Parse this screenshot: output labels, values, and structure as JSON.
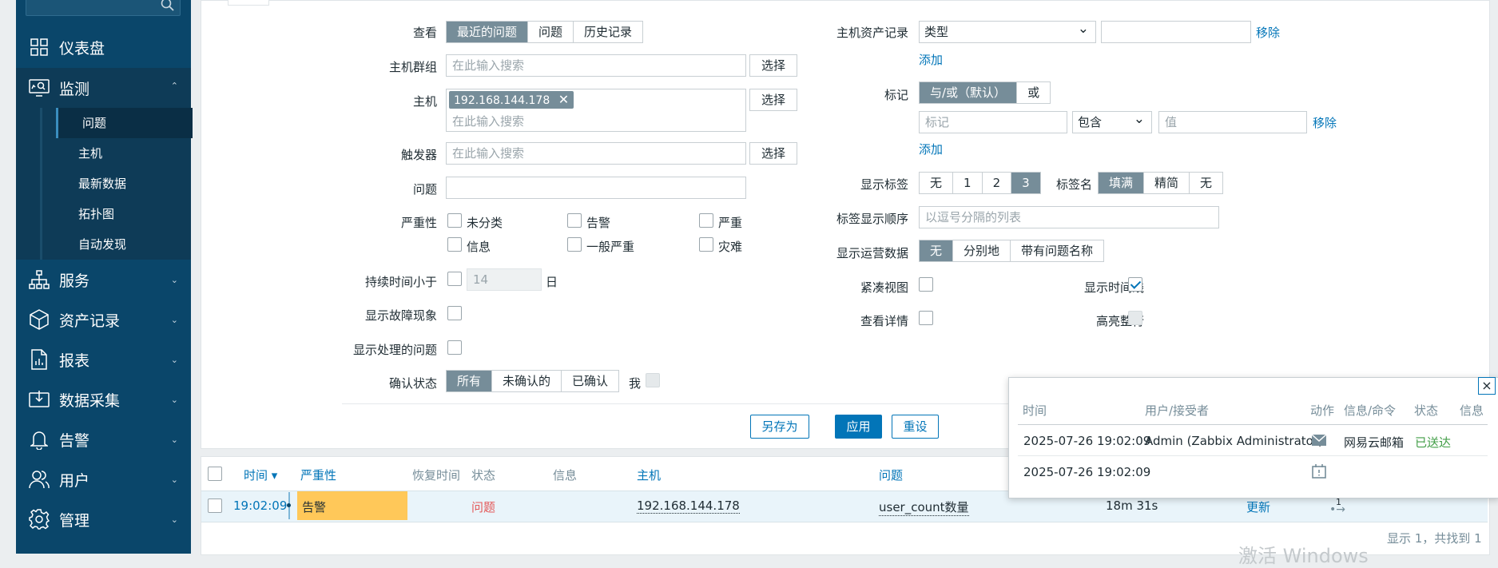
{
  "sidebar": {
    "items": [
      {
        "label": "仪表盘",
        "icon": "dashboard-icon"
      },
      {
        "label": "监测",
        "icon": "monitoring-icon"
      },
      {
        "label": "服务",
        "icon": "services-icon"
      },
      {
        "label": "资产记录",
        "icon": "inventory-icon"
      },
      {
        "label": "报表",
        "icon": "reports-icon"
      },
      {
        "label": "数据采集",
        "icon": "data-collection-icon"
      },
      {
        "label": "告警",
        "icon": "alerts-icon"
      },
      {
        "label": "用户",
        "icon": "users-icon"
      },
      {
        "label": "管理",
        "icon": "administration-icon"
      }
    ],
    "submenu": [
      "问题",
      "主机",
      "最新数据",
      "拓扑图",
      "自动发现"
    ]
  },
  "filter": {
    "show_label": "查看",
    "show_options": [
      "最近的问题",
      "问题",
      "历史记录"
    ],
    "host_groups_label": "主机群组",
    "hosts_label": "主机",
    "host_chip": "192.168.144.178",
    "triggers_label": "触发器",
    "problem_label": "问题",
    "search_placeholder": "在此输入搜索",
    "select_button": "选择",
    "severity_label": "严重性",
    "severities": [
      "未分类",
      "告警",
      "严重",
      "信息",
      "一般严重",
      "灾难"
    ],
    "age_label": "持续时间小于",
    "age_value": "14",
    "age_unit": "日",
    "show_symptoms_label": "显示故障现象",
    "show_suppressed_label": "显示处理的问题",
    "ack_label": "确认状态",
    "ack_options": [
      "所有",
      "未确认的",
      "已确认"
    ],
    "ack_me": "我",
    "inventory_label": "主机资产记录",
    "inventory_type": "类型",
    "remove_link": "移除",
    "add_link": "添加",
    "tags_label": "标记",
    "tags_mode": [
      "与/或（默认）",
      "或"
    ],
    "tag_placeholder": "标记",
    "tag_operator": "包含",
    "value_placeholder": "值",
    "show_tags_label": "显示标签",
    "show_tags_options": [
      "无",
      "1",
      "2",
      "3"
    ],
    "tag_name_label": "标签名",
    "tag_name_options": [
      "填满",
      "精简",
      "无"
    ],
    "tag_priority_label": "标签显示顺序",
    "tag_priority_placeholder": "以逗号分隔的列表",
    "opdata_label": "显示运营数据",
    "opdata_options": [
      "无",
      "分别地",
      "带有问题名称"
    ],
    "compact_view_label": "紧凑视图",
    "show_timeline_label": "显示时间线",
    "details_label": "查看详情",
    "highlight_row_label": "高亮整行",
    "save_as": "另存为",
    "apply": "应用",
    "reset": "重设"
  },
  "table": {
    "headers": [
      "时间 ▾",
      "严重性",
      "恢复时间",
      "状态",
      "信息",
      "主机",
      "问题"
    ],
    "row": {
      "time": "19:02:09",
      "severity": "告警",
      "status": "问题",
      "host": "192.168.144.178",
      "problem": "user_count数量",
      "duration": "18m 31s",
      "update": "更新",
      "actions_count": "1"
    },
    "footer": "显示 1，共找到 1",
    "watermark": "激活 Windows"
  },
  "popup": {
    "headers": [
      "时间",
      "用户/接受者",
      "动作",
      "信息/命令",
      "状态",
      "信息"
    ],
    "rows": [
      {
        "time": "2025-07-26 19:02:09",
        "user": "Admin (Zabbix Administrator)",
        "action_icon": "envelope-icon",
        "media": "网易云邮箱",
        "status": "已送达"
      },
      {
        "time": "2025-07-26 19:02:09",
        "user": "",
        "action_icon": "calendar-alert-icon",
        "media": "",
        "status": ""
      }
    ]
  },
  "colors": {
    "sidebar": "#0a466a",
    "accent": "#0275b8",
    "severity_warning": "#ffc859",
    "problem_red": "#e45959",
    "sent_green": "#429e47"
  }
}
